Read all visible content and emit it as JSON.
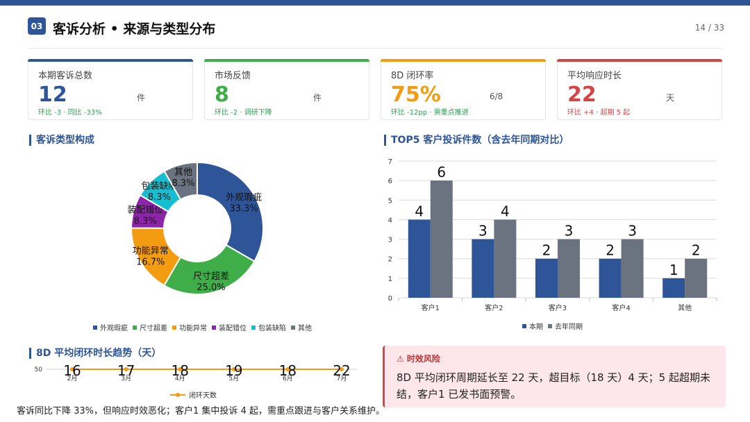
{
  "header": {
    "section_no": "03",
    "title": "客诉分析 • 来源与类型分布",
    "page": "14 / 33"
  },
  "kpis": [
    {
      "label": "本期客诉总数",
      "value": "12",
      "unit": "件",
      "note": "环比 -3 · 同比 -33%",
      "accent": "#2e5597",
      "value_color": "#2e5597",
      "note_color": "#2e9e52"
    },
    {
      "label": "市场反馈",
      "value": "8",
      "unit": "件",
      "note": "环比 -2 · 调研下降",
      "accent": "#3fae49",
      "value_color": "#3fae49",
      "note_color": "#2e9e52"
    },
    {
      "label": "8D 闭环率",
      "value": "75%",
      "unit": "6/8",
      "note": "环比 -12pp · 需重点推进",
      "accent": "#f39c12",
      "value_color": "#f39c12",
      "note_color": "#2e9e52"
    },
    {
      "label": "平均响应时长",
      "value": "22",
      "unit": "天",
      "note": "环比 +4 · 超期 5 起",
      "accent": "#d64545",
      "value_color": "#d64545",
      "note_color": "#d64545"
    }
  ],
  "pie_section": {
    "title": "客诉类型构成"
  },
  "bar_section": {
    "title": "TOP5 客户投诉件数（含去年同期对比）"
  },
  "line_section": {
    "title": "8D 平均闭环时长趋势（天）"
  },
  "risk": {
    "title": "⚠ 时效风险",
    "body": "8D 平均闭环周期延长至 22 天，超目标（18 天）4 天；5 起超期未结，客户1 已发书面预警。"
  },
  "footer": {
    "text": "客诉同比下降 33%，但响应时效恶化；客户1 集中投诉 4 起，需重点跟进与客户关系维护。"
  },
  "chart_data": [
    {
      "type": "pie",
      "title": "客诉类型构成",
      "categories": [
        "外观瑕疵",
        "尺寸超差",
        "功能异常",
        "装配错位",
        "包装缺陷",
        "其他"
      ],
      "values": [
        33.3,
        25.0,
        16.7,
        8.3,
        8.3,
        8.3
      ],
      "labels": [
        "33.3%",
        "25.0%",
        "16.7%",
        "8.3%",
        "8.3%",
        "8.3%"
      ],
      "colors": [
        "#2e5597",
        "#3fae49",
        "#f39c12",
        "#8e24aa",
        "#17becf",
        "#6b7280"
      ],
      "legend": "bottom"
    },
    {
      "type": "bar",
      "title": "TOP5 客户投诉件数（含去年同期对比）",
      "categories": [
        "客户1",
        "客户2",
        "客户3",
        "客户4",
        "其他"
      ],
      "series": [
        {
          "name": "本期",
          "values": [
            4,
            3,
            2,
            2,
            1
          ],
          "color": "#2e5597"
        },
        {
          "name": "去年同期",
          "values": [
            6,
            4,
            3,
            3,
            2
          ],
          "color": "#6b7280"
        }
      ],
      "ylim": [
        0,
        7
      ],
      "yticks": [
        "0",
        "1",
        "2",
        "3",
        "4",
        "5",
        "6",
        "7"
      ],
      "grid": true,
      "legend": "bottom"
    },
    {
      "type": "line",
      "title": "8D 平均闭环时长趋势（天）",
      "categories": [
        "2月",
        "3月",
        "4月",
        "5月",
        "6月",
        "7月"
      ],
      "series": [
        {
          "name": "闭环天数",
          "values": [
            16,
            17,
            18,
            19,
            18,
            22
          ],
          "color": "#f39c12"
        }
      ],
      "ytick_visible": "50",
      "legend": "bottom"
    }
  ]
}
